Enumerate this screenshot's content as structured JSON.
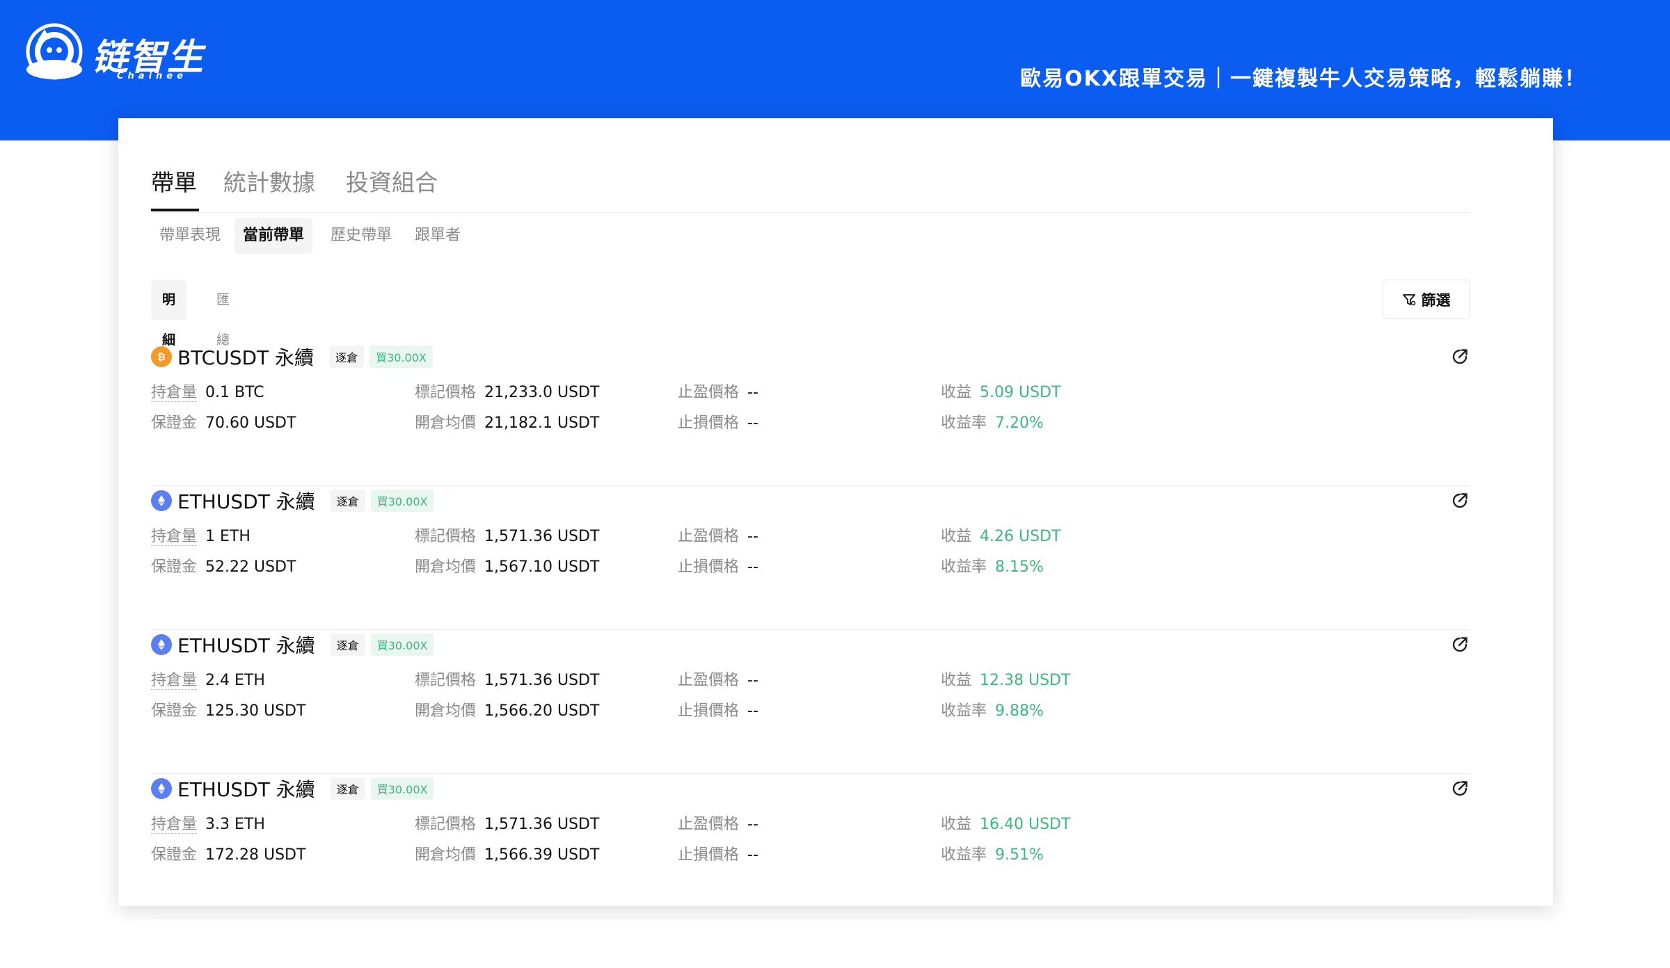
{
  "banner": {
    "logo_text": "链智生",
    "logo_sub": "Chainee",
    "slogan": "歐易OKX跟單交易｜一鍵複製牛人交易策略，輕鬆躺賺！"
  },
  "main_tabs": [
    "帶單",
    "統計數據",
    "投資組合"
  ],
  "sub_tabs": [
    "帶單表現",
    "當前帶單",
    "歷史帶單",
    "跟單者"
  ],
  "segment": [
    "明細",
    "匯總"
  ],
  "filter_label": "篩選",
  "labels": {
    "holding": "持倉量",
    "margin": "保證金",
    "mark_price": "標記價格",
    "open_avg": "開倉均價",
    "take_profit": "止盈價格",
    "stop_loss": "止損價格",
    "pnl": "收益",
    "pnl_rate": "收益率"
  },
  "positions": [
    {
      "coin": "btc",
      "title": "BTCUSDT 永續",
      "mode": "逐倉",
      "leverage": "買30.00X",
      "holding": "0.1 BTC",
      "margin": "70.60 USDT",
      "mark_price": "21,233.0 USDT",
      "open_avg": "21,182.1 USDT",
      "take_profit": "--",
      "stop_loss": "--",
      "pnl": "5.09 USDT",
      "pnl_rate": "7.20%"
    },
    {
      "coin": "eth",
      "title": "ETHUSDT 永續",
      "mode": "逐倉",
      "leverage": "買30.00X",
      "holding": "1 ETH",
      "margin": "52.22 USDT",
      "mark_price": "1,571.36 USDT",
      "open_avg": "1,567.10 USDT",
      "take_profit": "--",
      "stop_loss": "--",
      "pnl": "4.26 USDT",
      "pnl_rate": "8.15%"
    },
    {
      "coin": "eth",
      "title": "ETHUSDT 永續",
      "mode": "逐倉",
      "leverage": "買30.00X",
      "holding": "2.4 ETH",
      "margin": "125.30 USDT",
      "mark_price": "1,571.36 USDT",
      "open_avg": "1,566.20 USDT",
      "take_profit": "--",
      "stop_loss": "--",
      "pnl": "12.38 USDT",
      "pnl_rate": "9.88%"
    },
    {
      "coin": "eth",
      "title": "ETHUSDT 永續",
      "mode": "逐倉",
      "leverage": "買30.00X",
      "holding": "3.3 ETH",
      "margin": "172.28 USDT",
      "mark_price": "1,571.36 USDT",
      "open_avg": "1,566.39 USDT",
      "take_profit": "--",
      "stop_loss": "--",
      "pnl": "16.40 USDT",
      "pnl_rate": "9.51%"
    }
  ],
  "colors": {
    "banner": "#0b5cf0",
    "profit_green": "#3cb77e",
    "btc_orange": "#f39a2b",
    "eth_blue": "#5b7ef0"
  }
}
